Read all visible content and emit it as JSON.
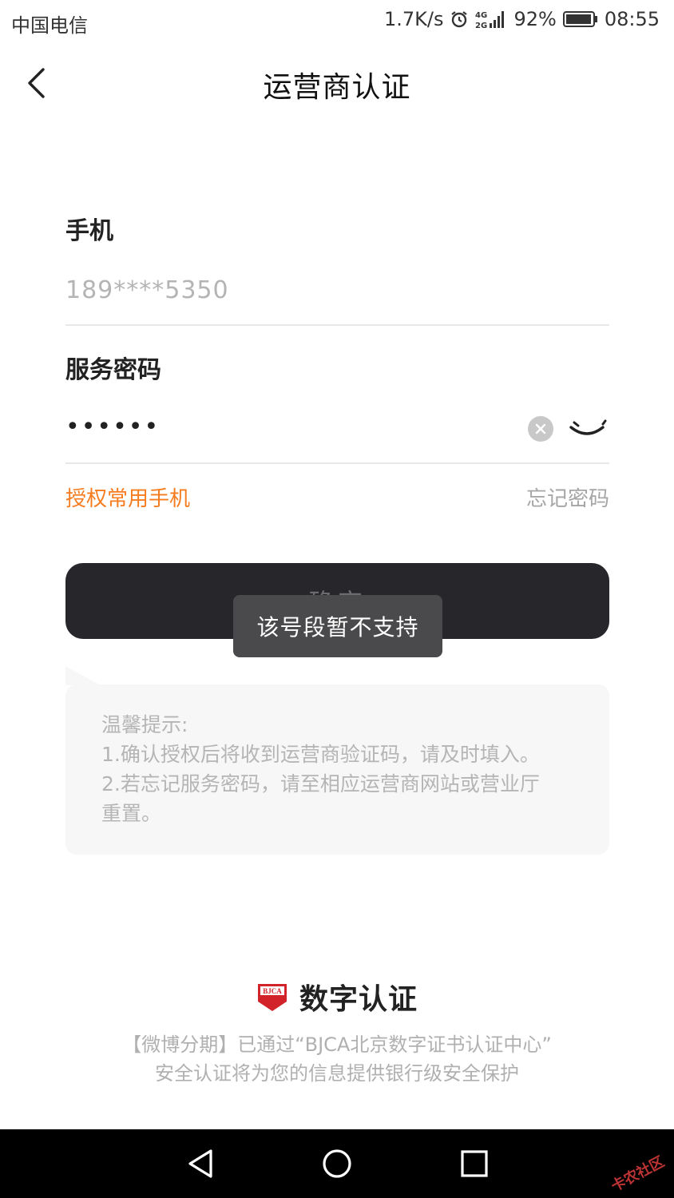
{
  "status_bar": {
    "carrier": "中国电信",
    "speed": "1.7K/s",
    "network": "4G 2G",
    "battery": "92%",
    "time": "08:55"
  },
  "nav": {
    "title": "运营商认证"
  },
  "form": {
    "phone_label": "手机",
    "phone_value": "189****5350",
    "password_label": "服务密码",
    "password_value": "••••••",
    "auth_link": "授权常用手机",
    "forgot_link": "忘记密码",
    "confirm_label": "确定"
  },
  "toast": {
    "message": "该号段暂不支持"
  },
  "tips": {
    "title": "温馨提示:",
    "line1": "1.确认授权后将收到运营商验证码，请及时填入。",
    "line2": "2.若忘记服务密码，请至相应运营商网站或营业厅",
    "line3": "重置。"
  },
  "footer": {
    "logo_text": "BJCA",
    "brand_name": "数字认证",
    "line1": "【微博分期】已通过“BJCA北京数字证书认证中心”",
    "line2": "安全认证将为您的信息提供银行级安全保护"
  },
  "watermark": "卡农社区",
  "colors": {
    "accent": "#f57c1f",
    "button_bg": "#27262b",
    "brand_red": "#d2232a"
  }
}
